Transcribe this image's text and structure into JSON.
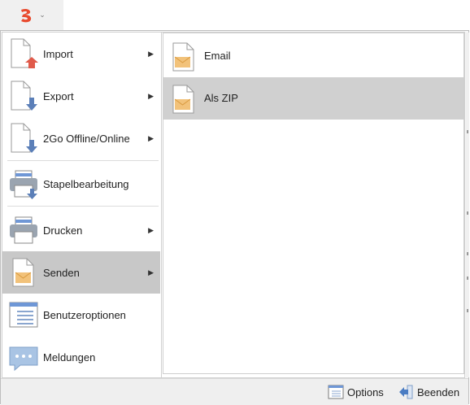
{
  "app_button": {
    "icon": "app-logo-icon",
    "chevron": "chevron-down-icon"
  },
  "menu": {
    "items": [
      {
        "label": "Import",
        "icon": "document-arrow-up-icon",
        "submenu": true
      },
      {
        "label": "Export",
        "icon": "document-arrow-down-icon",
        "submenu": true
      },
      {
        "label": "2Go Offline/Online",
        "icon": "document-arrow-down-icon",
        "submenu": true
      },
      {
        "label": "Stapelbearbeitung",
        "icon": "printer-arrow-icon",
        "submenu": false
      },
      {
        "label": "Drucken",
        "icon": "printer-icon",
        "submenu": true
      },
      {
        "label": "Senden",
        "icon": "document-envelope-icon",
        "submenu": true,
        "selected": true
      },
      {
        "label": "Benutzeroptionen",
        "icon": "window-list-icon",
        "submenu": false
      },
      {
        "label": "Meldungen",
        "icon": "chat-bubble-icon",
        "submenu": false
      }
    ]
  },
  "submenu": {
    "items": [
      {
        "label": "Email",
        "icon": "document-envelope-icon"
      },
      {
        "label": "Als ZIP",
        "icon": "document-envelope-icon",
        "selected": true
      }
    ]
  },
  "footer": {
    "options_label": "Options",
    "exit_label": "Beenden"
  },
  "colors": {
    "selected_bg": "#c8c8c8",
    "accent_blue": "#5b7fb8",
    "arrow_red": "#e05a4a",
    "envelope": "#f2c27a"
  }
}
